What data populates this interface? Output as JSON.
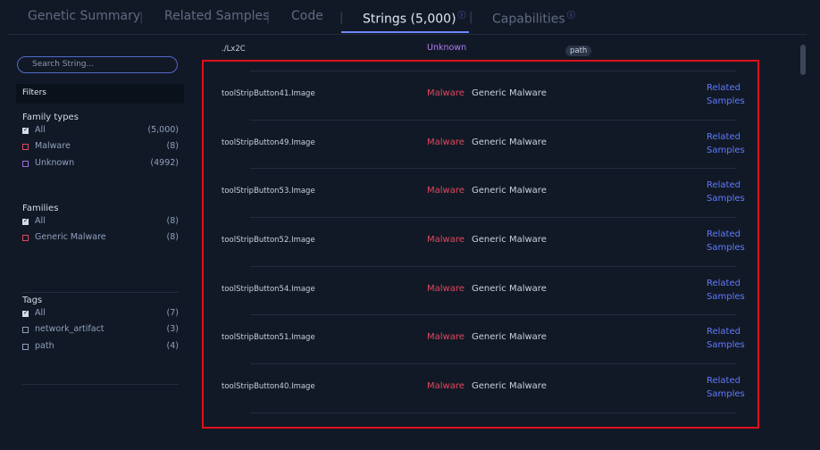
{
  "tabs": [
    {
      "label": "Genetic Summary"
    },
    {
      "label": "Related Samples"
    },
    {
      "label": "Code"
    },
    {
      "label": "Strings (5,000)",
      "info_icon": "ⓘ"
    },
    {
      "label": "Capabilities",
      "info_icon": "ⓘ"
    }
  ],
  "tab_separator": "|",
  "active_tab": "Strings (5,000)",
  "search": {
    "placeholder": "Search String..."
  },
  "filters": {
    "title": "Filters",
    "family_types": {
      "title": "Family types",
      "items": [
        {
          "label": "All",
          "count": "(5,000)",
          "checked": true
        },
        {
          "label": "Malware",
          "count": "(8)",
          "checked": false
        },
        {
          "label": "Unknown",
          "count": "(4992)",
          "checked": false
        }
      ]
    },
    "families": {
      "title": "Families",
      "items": [
        {
          "label": "All",
          "count": "(8)",
          "checked": true
        },
        {
          "label": "Generic Malware",
          "count": "(8)",
          "checked": false
        }
      ]
    },
    "tags": {
      "title": "Tags",
      "items": [
        {
          "label": "All",
          "count": "(7)",
          "checked": true
        },
        {
          "label": "network_artifact",
          "count": "(3)",
          "checked": false
        },
        {
          "label": "path",
          "count": "(4)",
          "checked": false
        }
      ]
    }
  },
  "header_row": {
    "string": "./Lx2C",
    "family_type": "Unknown",
    "tag": "path"
  },
  "rows": [
    {
      "string": "toolStripButton41.Image",
      "family_type": "Malware",
      "family": "Generic Malware",
      "link_line1": "Related",
      "link_line2": "Samples"
    },
    {
      "string": "toolStripButton49.Image",
      "family_type": "Malware",
      "family": "Generic Malware",
      "link_line1": "Related",
      "link_line2": "Samples"
    },
    {
      "string": "toolStripButton53.Image",
      "family_type": "Malware",
      "family": "Generic Malware",
      "link_line1": "Related",
      "link_line2": "Samples"
    },
    {
      "string": "toolStripButton52.Image",
      "family_type": "Malware",
      "family": "Generic Malware",
      "link_line1": "Related",
      "link_line2": "Samples"
    },
    {
      "string": "toolStripButton54.Image",
      "family_type": "Malware",
      "family": "Generic Malware",
      "link_line1": "Related",
      "link_line2": "Samples"
    },
    {
      "string": "toolStripButton51.Image",
      "family_type": "Malware",
      "family": "Generic Malware",
      "link_line1": "Related",
      "link_line2": "Samples"
    },
    {
      "string": "toolStripButton40.Image",
      "family_type": "Malware",
      "family": "Generic Malware",
      "link_line1": "Related",
      "link_line2": "Samples"
    }
  ],
  "colors": {
    "accent": "#6f86ff",
    "malware": "#e0485e",
    "unknown": "#b07cf0",
    "highlight_border": "#e0101a",
    "background": "#121926"
  }
}
